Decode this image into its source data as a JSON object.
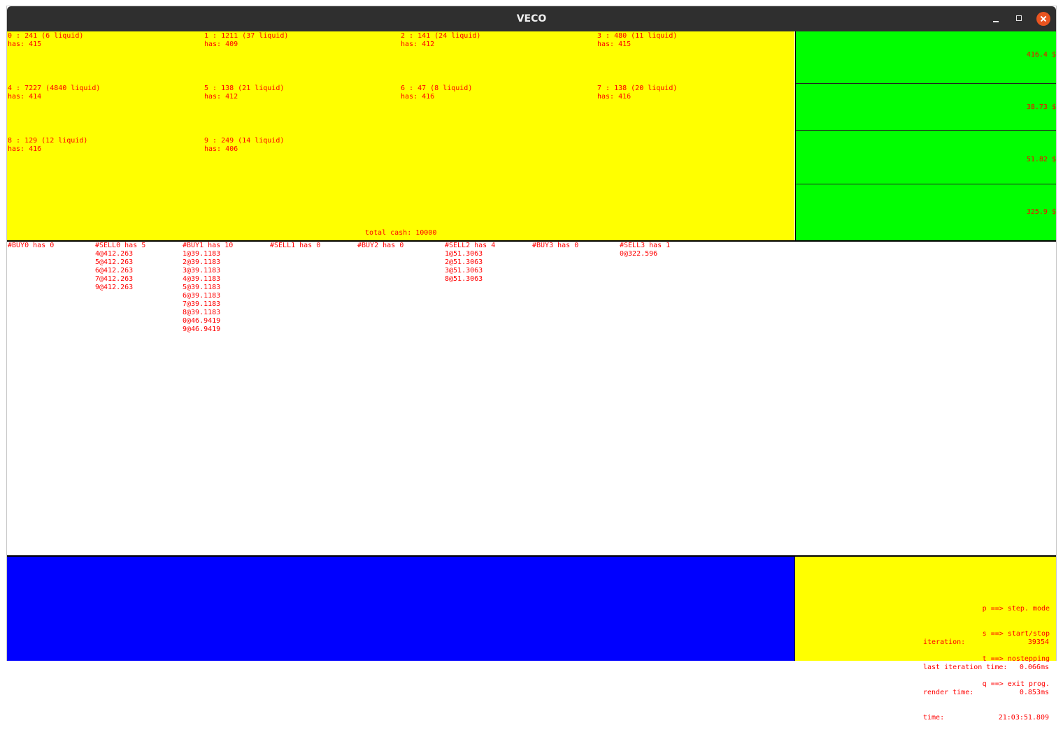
{
  "window": {
    "title": "VECO"
  },
  "accounts": [
    {
      "line1": "0 : 241 (6 liquid)",
      "line2": "has: 415"
    },
    {
      "line1": "1 : 1211 (37 liquid)",
      "line2": "has: 409"
    },
    {
      "line1": "2 : 141 (24 liquid)",
      "line2": "has: 412"
    },
    {
      "line1": "3 : 480 (11 liquid)",
      "line2": "has: 415"
    },
    {
      "line1": "4 : 7227 (4840 liquid)",
      "line2": "has: 414"
    },
    {
      "line1": "5 : 138 (21 liquid)",
      "line2": "has: 412"
    },
    {
      "line1": "6 : 47 (8 liquid)",
      "line2": "has: 416"
    },
    {
      "line1": "7 : 138 (20 liquid)",
      "line2": "has: 416"
    },
    {
      "line1": "8 : 129 (12 liquid)",
      "line2": "has: 416"
    },
    {
      "line1": "9 : 249 (14 liquid)",
      "line2": "has: 406"
    }
  ],
  "total_cash": "total cash: 10000",
  "prices": [
    "416.4 $",
    "38.73 $",
    "51.82 $",
    "325.9 $"
  ],
  "orders": [
    {
      "header": "#BUY0 has 0",
      "entries": ""
    },
    {
      "header": "#SELL0 has 5",
      "entries": "4@412.263\n5@412.263\n6@412.263\n7@412.263\n9@412.263"
    },
    {
      "header": "#BUY1 has 10",
      "entries": "1@39.1183\n2@39.1183\n3@39.1183\n4@39.1183\n5@39.1183\n6@39.1183\n7@39.1183\n8@39.1183\n0@46.9419\n9@46.9419"
    },
    {
      "header": "#SELL1 has 0",
      "entries": ""
    },
    {
      "header": "#BUY2 has 0",
      "entries": ""
    },
    {
      "header": "#SELL2 has 4",
      "entries": "1@51.3063\n2@51.3063\n3@51.3063\n8@51.3063"
    },
    {
      "header": "#BUY3 has 0",
      "entries": ""
    },
    {
      "header": "#SELL3 has 1",
      "entries": "0@322.596"
    }
  ],
  "keys": [
    "p ==> step. mode",
    "s ==> start/stop",
    "t ==> nostepping",
    "q ==> exit prog."
  ],
  "stats": {
    "iteration_label": "iteration:",
    "iteration_value": "39354",
    "last_iter_label": "last iteration time:",
    "last_iter_value": "0.066ms",
    "render_label": "render time:",
    "render_value": "0.853ms",
    "time_label": "time:",
    "time_value": "21:03:51.809"
  },
  "colors": {
    "yellow": "#ffff00",
    "green": "#00ff00",
    "blue": "#0000ff",
    "text_red": "#ff0000",
    "close_button": "#e95420"
  }
}
